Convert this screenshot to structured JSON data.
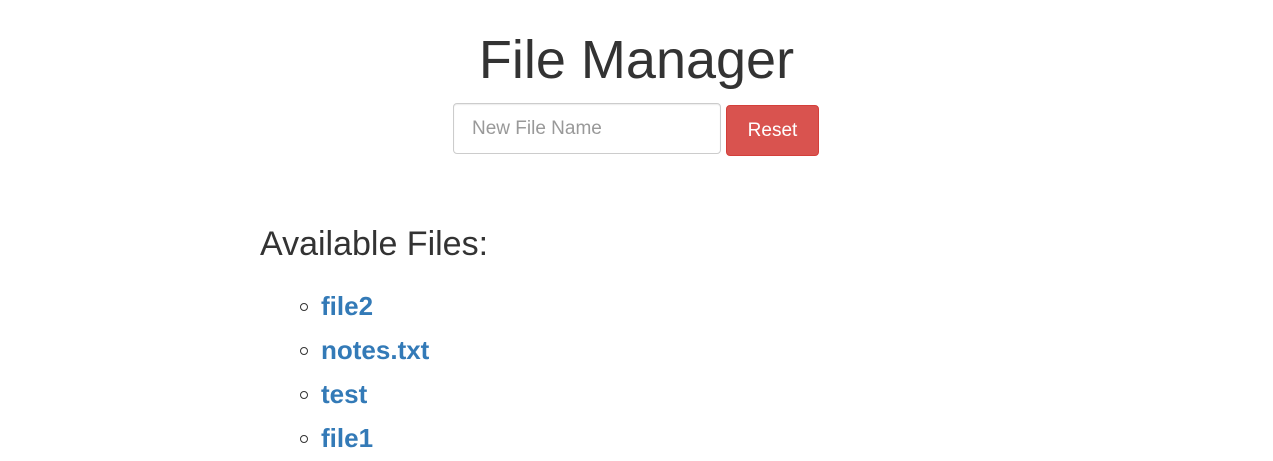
{
  "header": {
    "title": "File Manager"
  },
  "controls": {
    "new_file_placeholder": "New File Name",
    "new_file_value": "",
    "reset_label": "Reset"
  },
  "files_section": {
    "heading": "Available Files:",
    "files": [
      {
        "name": "file2"
      },
      {
        "name": "notes.txt"
      },
      {
        "name": "test"
      },
      {
        "name": "file1"
      }
    ]
  },
  "colors": {
    "link": "#337ab7",
    "danger_button": "#d9534f",
    "text": "#333333"
  },
  "icons": {
    "list_bullet": "hollow-circle-bullet-icon"
  }
}
